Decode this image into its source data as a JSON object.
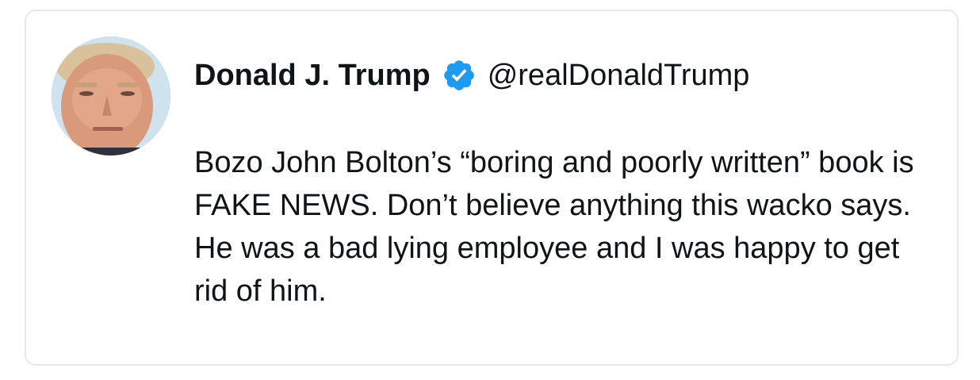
{
  "tweet": {
    "display_name": "Donald J. Trump",
    "handle": "@realDonaldTrump",
    "verified": true,
    "text": "Bozo John Bolton’s “boring and poorly written” book is FAKE NEWS. Don’t believe anything this wacko says. He was a bad lying employee and I was happy to get rid of him.",
    "avatar_icon": "profile-photo",
    "verified_icon": "verified-badge-icon"
  },
  "colors": {
    "text": "#0f1419",
    "verified_blue": "#1d9bf0",
    "card_border": "#e6e8ea",
    "background": "#ffffff"
  }
}
